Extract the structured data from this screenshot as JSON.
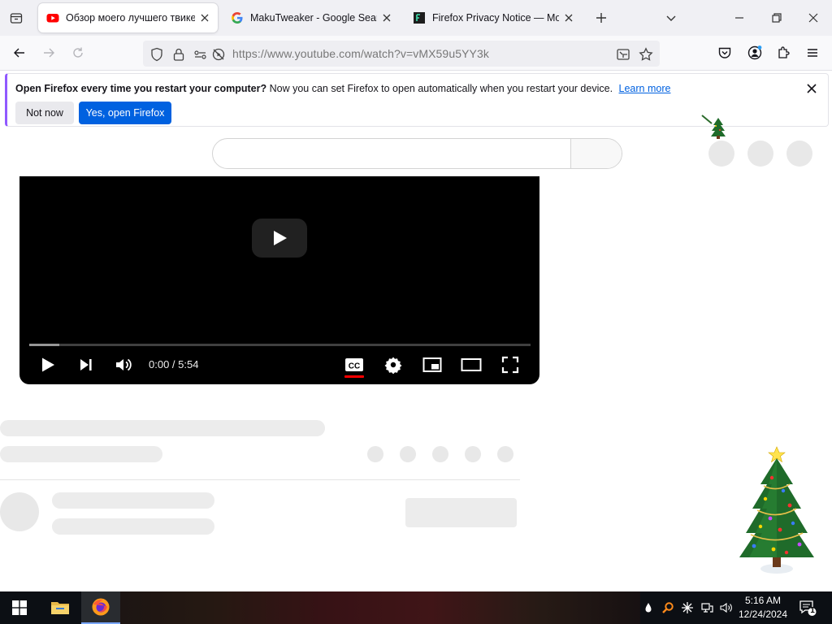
{
  "tabs": [
    {
      "title": "Обзор моего лучшего твикер",
      "favicon": "youtube-icon",
      "active": true
    },
    {
      "title": "MakuTweaker - Google Search",
      "favicon": "google-icon",
      "active": false
    },
    {
      "title": "Firefox Privacy Notice — Mozill",
      "favicon": "mozilla-icon",
      "active": false
    }
  ],
  "navbar": {
    "url": "https://www.youtube.com/watch?v=vMX59u5YY3k"
  },
  "notification": {
    "bold": "Open Firefox every time you restart your computer?",
    "text": "Now you can set Firefox to open automatically when you restart your device.",
    "link": "Learn more",
    "not_now": "Not now",
    "yes_open": "Yes, open Firefox"
  },
  "player": {
    "time": "0:00 / 5:54",
    "loaded_fraction": 0.06
  },
  "taskbar": {
    "time": "5:16 AM",
    "date": "12/24/2024",
    "notification_count": "1"
  },
  "colors": {
    "accent": "#0061e0",
    "youtube_red": "#ff0000",
    "tree_green": "#1f6b2a"
  }
}
